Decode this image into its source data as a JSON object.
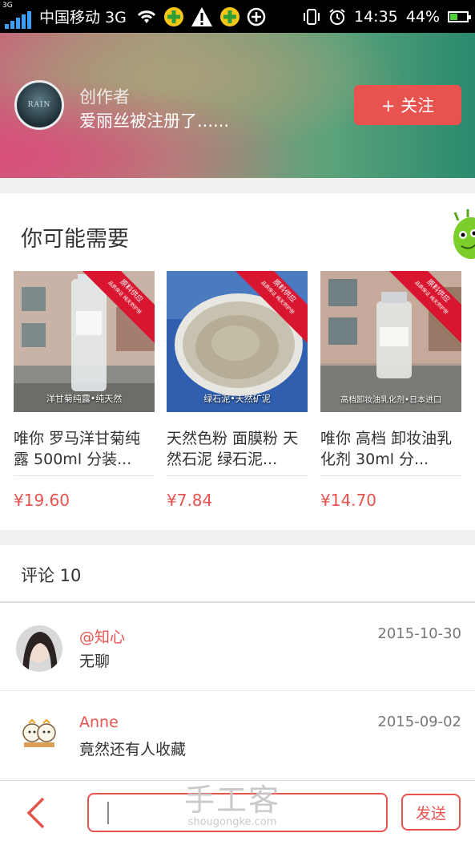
{
  "status_bar": {
    "network_type": "3G",
    "carrier": "中国移动 3G",
    "time": "14:35",
    "battery": "44%",
    "battery_level": 0.44,
    "signal_color": "#3aa0ff",
    "icons": [
      "wifi-icon",
      "app-notification-icon",
      "warning-icon",
      "app-notification-icon",
      "add-circle-icon",
      "vibrate-icon",
      "alarm-icon",
      "battery-icon"
    ]
  },
  "header": {
    "avatar_text": "RAIN",
    "creator_label": "创作者",
    "creator_name": "爱丽丝被注册了......",
    "follow_label": "+ 关注"
  },
  "recommendations": {
    "title": "你可能需要",
    "items": [
      {
        "ribbon": "原料供应",
        "ribbon_sub": "品质保证 纯天然护肤",
        "caption": "洋甘菊纯露•纯天然",
        "name": "唯你 罗马洋甘菊纯露 500ml 分装...",
        "price": "¥19.60"
      },
      {
        "ribbon": "原料供应",
        "ribbon_sub": "品质保证 纯天然护肤",
        "caption": "绿石泥•天然矿泥",
        "name": "天然色粉 面膜粉 天然石泥 绿石泥...",
        "price": "¥7.84"
      },
      {
        "ribbon": "原料供应",
        "ribbon_sub": "品质保证 纯天然护肤",
        "caption": "高档卸妆油乳化剂•日本进口",
        "name": "唯你 高档 卸妆油乳化剂 30ml 分...",
        "price": "¥14.70"
      }
    ]
  },
  "comments": {
    "title": "评论 10",
    "items": [
      {
        "user": "@知心",
        "date": "2015-10-30",
        "text": "无聊"
      },
      {
        "user": "Anne",
        "date": "2015-09-02",
        "text": "竟然还有人收藏"
      }
    ]
  },
  "bottom_bar": {
    "input_placeholder": "",
    "watermark": "手工客",
    "watermark_sub": "shougongke.com",
    "send_label": "发送"
  },
  "colors": {
    "accent": "#e8534f",
    "price": "#e8534f",
    "ribbon": "#d8162f"
  }
}
